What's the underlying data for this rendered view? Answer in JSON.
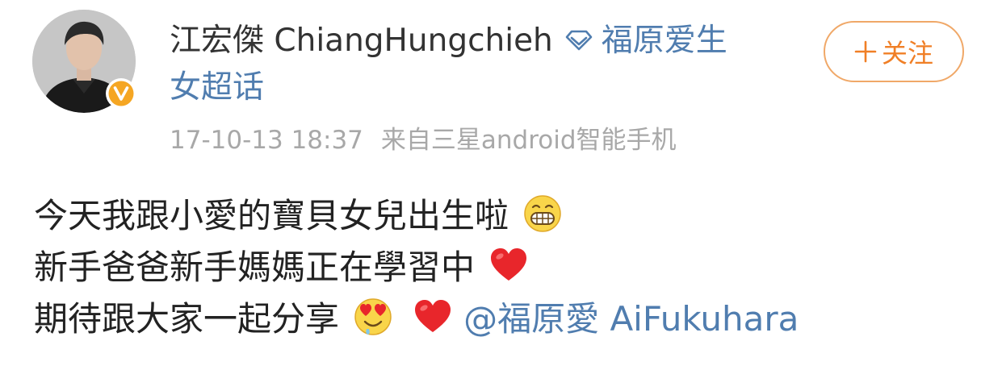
{
  "post": {
    "author": {
      "username": "江宏傑 ChiangHungchieh",
      "avatar_icon": "avatar",
      "verified_icon": "verified-badge-icon",
      "member_icon": "diamond-icon"
    },
    "topic": {
      "label_part1": "福原爱生",
      "label_part2": "女超话"
    },
    "meta": {
      "timestamp": "17-10-13 18:37",
      "source": "来自三星android智能手机"
    },
    "follow_button": {
      "label": "关注",
      "icon": "plus-icon"
    },
    "body": {
      "line1": "今天我跟小愛的寶貝女兒出生啦",
      "line2": "新手爸爸新手媽媽正在學習中",
      "line3": "期待跟大家一起分享",
      "mention": "@福原愛 AiFukuhara"
    },
    "colors": {
      "link": "#507daf",
      "follow_accent": "#f07f26",
      "meta_gray": "#a8a8a8",
      "verified_orange": "#f5a623",
      "heart_red": "#e8262b"
    }
  }
}
